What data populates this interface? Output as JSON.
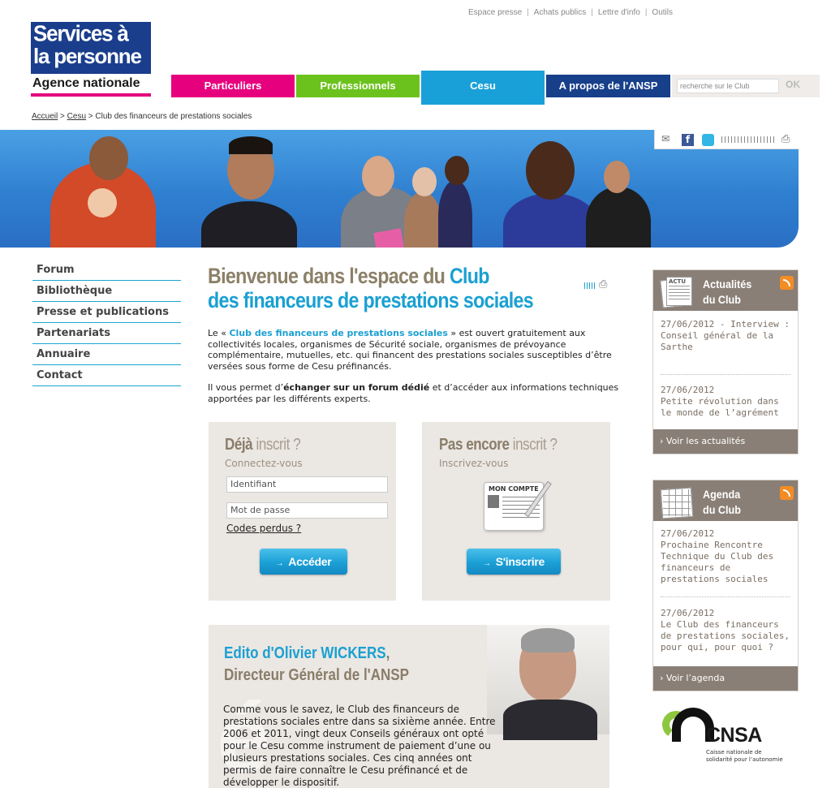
{
  "top_links": [
    "Espace presse",
    "Achats publics",
    "Lettre d'info",
    "Outils"
  ],
  "logo": {
    "line1": "Services à",
    "line2": "la personne",
    "agency": "Agence nationale"
  },
  "nav": {
    "items": [
      {
        "label": "Particuliers",
        "color": "#e6007e"
      },
      {
        "label": "Professionnels",
        "color": "#6cc21d"
      },
      {
        "label": "Cesu",
        "color": "#1aa0d8"
      },
      {
        "label": "A propos de l'ANSP",
        "color": "#173f8a"
      }
    ],
    "search_placeholder": "recherche sur le Club",
    "search_ok": "OK"
  },
  "breadcrumb": {
    "home": "Accueil",
    "sep": ">",
    "section": "Cesu",
    "current": "Club des financeurs de prestations sociales"
  },
  "left_menu": [
    "Forum",
    "Bibliothèque",
    "Presse et publications",
    "Partenariats",
    "Annuaire",
    "Contact"
  ],
  "main": {
    "title_part1": "Bienvenue dans l'espace du ",
    "title_part2": "Club",
    "title_line2": "des financeurs de prestations sociales",
    "intro_p1_a": "Le « ",
    "intro_p1_link": "Club des financeurs de prestations sociales",
    "intro_p1_b": " » est ouvert gratuitement aux collectivités locales, organismes de Sécurité sociale, organismes de prévoyance complémentaire, mutuelles, etc. qui financent des prestations sociales susceptibles d’être versées sous forme de Cesu préfinancés.",
    "intro_p2_a": "Il vous permet d’",
    "intro_p2_bold": "échanger sur un forum dédié",
    "intro_p2_b": " et d’accéder aux informations techniques apportées par les différents experts."
  },
  "login": {
    "title_dark": "Déjà",
    "title_light": " inscrit ?",
    "subtitle": "Connectez-vous",
    "username_placeholder": "Identifiant",
    "password_placeholder": "Mot de passe",
    "forgot": "Codes perdus ?",
    "button": "Accéder"
  },
  "register": {
    "title_dark": "Pas encore",
    "title_light": " inscrit ?",
    "subtitle": "Inscrivez-vous",
    "card_label": "MON COMPTE",
    "button": "S'inscrire"
  },
  "edito": {
    "title_blue": "Edito d'Olivier WICKERS",
    "title_comma": ",",
    "subtitle": "Directeur Général de l'ANSP",
    "text": "Comme vous le savez, le Club des financeurs de prestations sociales entre dans sa sixième année. Entre 2006 et 2011, vingt deux Conseils généraux ont opté pour le Cesu comme instrument de paiement d’une ou plusieurs prestations sociales. Ces cinq années ont permis de faire connaître le Cesu préfinancé et de développer le dispositif."
  },
  "news": {
    "icon_label": "ACTU",
    "title1": "Actualités",
    "title2": "du Club",
    "items": [
      {
        "date": "27/06/2012",
        "text": " - Interview : Conseil général de la Sarthe"
      },
      {
        "date": "27/06/2012",
        "text": "Petite révolution dans le monde de l’agrément"
      }
    ],
    "footer": "Voir les actualités"
  },
  "agenda": {
    "title1": "Agenda",
    "title2": "du Club",
    "items": [
      {
        "date": "27/06/2012",
        "text": "Prochaine Rencontre Technique du Club des financeurs de prestations sociales"
      },
      {
        "date": "27/06/2012",
        "text": "Le Club des financeurs de prestations sociales, pour qui, pour quoi ?"
      }
    ],
    "footer": "Voir l’agenda"
  },
  "cnsa": {
    "name": "CNSA",
    "line1": "Caisse nationale de",
    "line2": "solidarité pour l’autonomie"
  },
  "colors": {
    "accent_blue": "#1aa0d2",
    "taupe": "#8a7f76",
    "panel_bg": "#ebe7e3"
  }
}
